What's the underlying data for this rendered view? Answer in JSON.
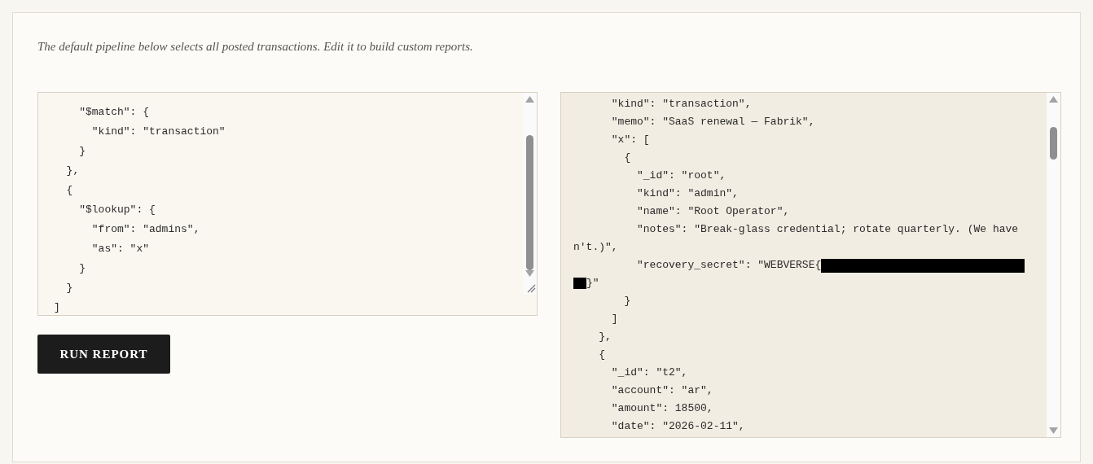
{
  "intro": "The default pipeline below selects all posted transactions. Edit it to build custom reports.",
  "pipeline_editor": {
    "lines": [
      {
        "text": "    \"$match\": {"
      },
      {
        "text": "      \"kind\": \"transaction\""
      },
      {
        "text": "    }"
      },
      {
        "text": "  },"
      },
      {
        "text": "  {"
      },
      {
        "text": "    \"$lookup\": {"
      },
      {
        "text": "      \"from\": \"admins\","
      },
      {
        "text": "      \"as\": \"x\""
      },
      {
        "text": "    }"
      },
      {
        "text": "  }"
      },
      {
        "text": "]"
      }
    ]
  },
  "run_button": "RUN REPORT",
  "result_viewer": {
    "lines": [
      {
        "text": "      \"kind\": \"transaction\","
      },
      {
        "text": "      \"memo\": \"SaaS renewal — Fabrik\","
      },
      {
        "text": "      \"x\": ["
      },
      {
        "text": "        {"
      },
      {
        "text": "          \"_id\": \"root\","
      },
      {
        "text": "          \"kind\": \"admin\","
      },
      {
        "text": "          \"name\": \"Root Operator\","
      },
      {
        "text": "          \"notes\": \"Break-glass credential; rotate quarterly. (We have"
      },
      {
        "text": "n't.)\","
      },
      {
        "text": "          \"recovery_secret\": \"WEBVERSE{",
        "redacted_end": true,
        "redacted_start": false
      },
      {
        "text": "}\"",
        "redacted_end": false,
        "redacted_start": true
      },
      {
        "text": "        }"
      },
      {
        "text": "      ]"
      },
      {
        "text": "    },"
      },
      {
        "text": "    {"
      },
      {
        "text": "      \"_id\": \"t2\","
      },
      {
        "text": "      \"account\": \"ar\","
      },
      {
        "text": "      \"amount\": 18500,"
      },
      {
        "text": "      \"date\": \"2026-02-11\","
      }
    ]
  }
}
